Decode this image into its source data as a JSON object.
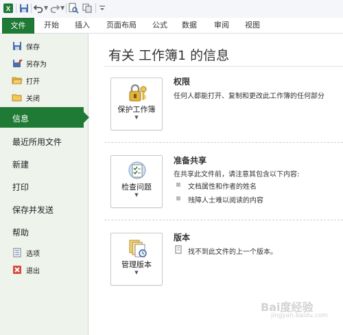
{
  "colors": {
    "accent": "#1f7a35",
    "left_pane_bg": "#eef3ec"
  },
  "qat": {
    "icons": [
      "excel-logo-icon",
      "save-icon",
      "undo-icon",
      "redo-icon",
      "print-preview-icon",
      "copy-icon",
      "customize-icon"
    ]
  },
  "ribbon": {
    "file_tab": "文件",
    "tabs": [
      "开始",
      "插入",
      "页面布局",
      "公式",
      "数据",
      "审阅",
      "视图"
    ]
  },
  "backstage": {
    "commands": [
      {
        "label": "保存",
        "icon": "save-icon"
      },
      {
        "label": "另存为",
        "icon": "save-as-icon"
      },
      {
        "label": "打开",
        "icon": "open-folder-icon"
      },
      {
        "label": "关闭",
        "icon": "close-folder-icon"
      }
    ],
    "active": "信息",
    "nav": [
      "最近所用文件",
      "新建",
      "打印",
      "保存并发送",
      "帮助"
    ],
    "bottom": [
      {
        "label": "选项",
        "icon": "options-icon"
      },
      {
        "label": "退出",
        "icon": "exit-icon"
      }
    ]
  },
  "info": {
    "title": "有关 工作簿1 的信息",
    "sections": [
      {
        "button": "保护工作簿",
        "icon": "lock-key-icon",
        "heading": "权限",
        "text": "任何人都能打开、复制和更改此工作簿的任何部分"
      },
      {
        "button": "检查问题",
        "icon": "checklist-icon",
        "heading": "准备共享",
        "text": "在共享此文件前，请注意其包含以下内容:",
        "bullets": [
          "文档属性和作者的姓名",
          "残障人士难以阅读的内容"
        ]
      },
      {
        "button": "管理版本",
        "icon": "versions-icon",
        "heading": "版本",
        "text": "找不到此文件的上一个版本。"
      }
    ]
  },
  "watermark": {
    "main": "Bai度经验",
    "sub": "jingyan.baidu.com"
  }
}
